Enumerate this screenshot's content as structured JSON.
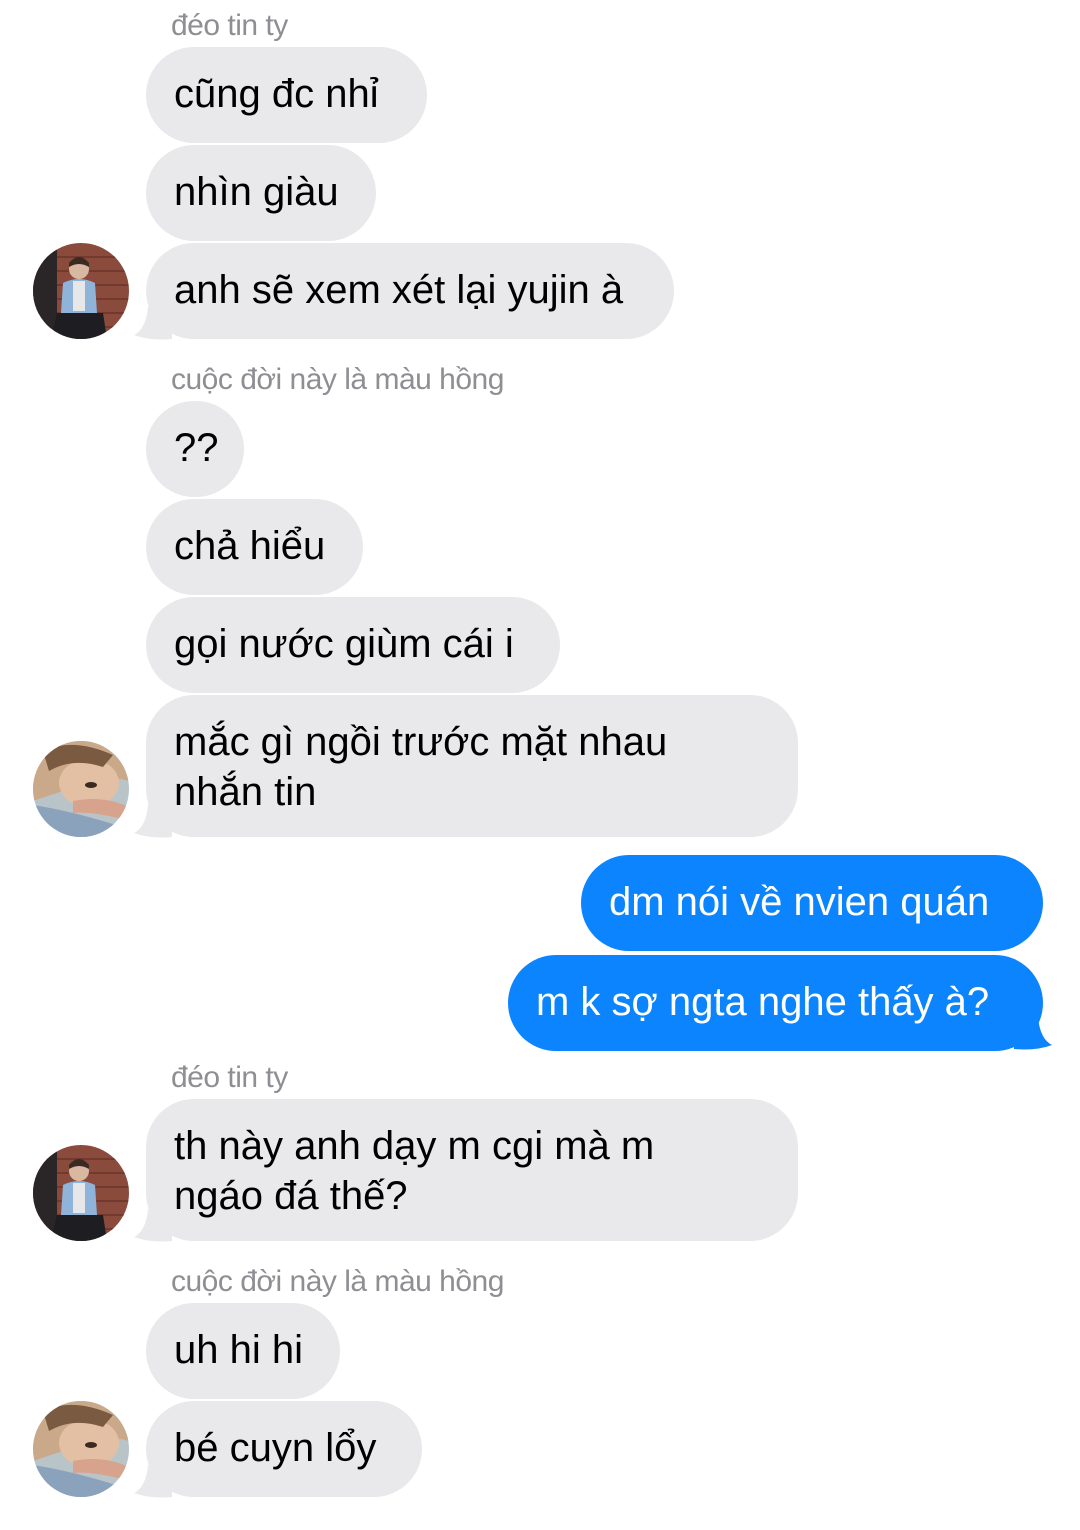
{
  "messages": [
    {
      "type": "sender",
      "text": "đéo tin ty"
    },
    {
      "type": "in",
      "text": "cũng đc nhỉ"
    },
    {
      "type": "in",
      "text": "nhìn giàu"
    },
    {
      "type": "in",
      "text": "anh sẽ xem xét lại yujin à"
    },
    {
      "type": "sender",
      "text": "cuộc đời này là màu hồng"
    },
    {
      "type": "in",
      "text": "??"
    },
    {
      "type": "in",
      "text": "chả hiểu"
    },
    {
      "type": "in",
      "text": "gọi nước giùm cái i"
    },
    {
      "type": "in",
      "lines": [
        "mắc gì ngồi trước mặt nhau",
        "nhắn tin"
      ]
    },
    {
      "type": "out",
      "text": "dm nói về nvien quán"
    },
    {
      "type": "out",
      "text": "m k sợ ngta nghe thấy à?"
    },
    {
      "type": "sender",
      "text": "đéo tin ty"
    },
    {
      "type": "in",
      "lines": [
        "th này anh dạy m cgi mà m",
        "ngáo đá thế?"
      ]
    },
    {
      "type": "sender",
      "text": "cuộc đời này là màu hồng"
    },
    {
      "type": "in",
      "text": "uh hi hi"
    },
    {
      "type": "in",
      "text": "bé cuyn lổy"
    }
  ],
  "avatars": [
    {
      "person": "đéo tin ty",
      "icon": "avatar-photo-icon"
    },
    {
      "person": "cuộc đời này là màu hồng",
      "icon": "avatar-photo-icon"
    }
  ],
  "colors": {
    "incoming_bubble": "#e9e9eb",
    "outgoing_bubble": "#0b84fe",
    "sender_label": "#8e8e93"
  }
}
